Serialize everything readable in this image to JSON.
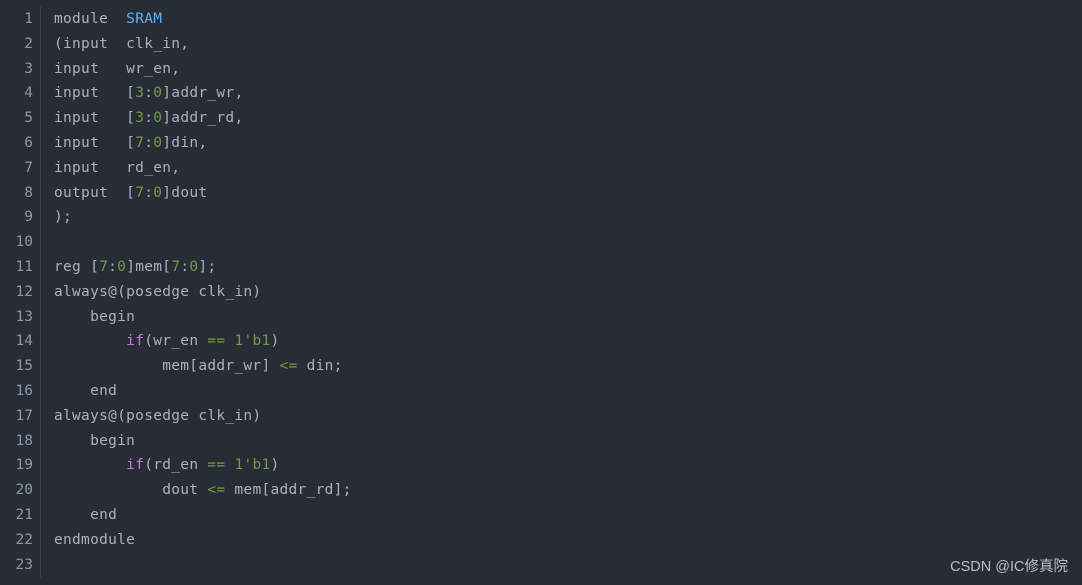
{
  "editor": {
    "language": "verilog",
    "background_color": "#282c34",
    "default_text_color": "#abb2bf",
    "gutter_text_color": "#8b98ab",
    "gutter_divider_color": "#3f4550",
    "total_lines": 23,
    "colors": {
      "type": "#61afef",
      "keyword": "#c678dd",
      "number": "#6f9b4b",
      "operator": "#6f9b4b",
      "plain": "#abb2bf"
    },
    "lines": [
      {
        "number": "1",
        "text": "module  SRAM",
        "tokens": [
          {
            "t": "module  ",
            "c": "plain"
          },
          {
            "t": "SRAM",
            "c": "type"
          }
        ]
      },
      {
        "number": "2",
        "text": "(input  clk_in,",
        "tokens": [
          {
            "t": "(input  clk_in,",
            "c": "plain"
          }
        ]
      },
      {
        "number": "3",
        "text": "input   wr_en,",
        "tokens": [
          {
            "t": "input   wr_en,",
            "c": "plain"
          }
        ]
      },
      {
        "number": "4",
        "text": "input   [3:0]addr_wr,",
        "tokens": [
          {
            "t": "input   [",
            "c": "plain"
          },
          {
            "t": "3",
            "c": "number"
          },
          {
            "t": ":",
            "c": "plain"
          },
          {
            "t": "0",
            "c": "number"
          },
          {
            "t": "]addr_wr,",
            "c": "plain"
          }
        ]
      },
      {
        "number": "5",
        "text": "input   [3:0]addr_rd,",
        "tokens": [
          {
            "t": "input   [",
            "c": "plain"
          },
          {
            "t": "3",
            "c": "number"
          },
          {
            "t": ":",
            "c": "plain"
          },
          {
            "t": "0",
            "c": "number"
          },
          {
            "t": "]addr_rd,",
            "c": "plain"
          }
        ]
      },
      {
        "number": "6",
        "text": "input   [7:0]din,",
        "tokens": [
          {
            "t": "input   [",
            "c": "plain"
          },
          {
            "t": "7",
            "c": "number"
          },
          {
            "t": ":",
            "c": "plain"
          },
          {
            "t": "0",
            "c": "number"
          },
          {
            "t": "]din,",
            "c": "plain"
          }
        ]
      },
      {
        "number": "7",
        "text": "input   rd_en,",
        "tokens": [
          {
            "t": "input   rd_en,",
            "c": "plain"
          }
        ]
      },
      {
        "number": "8",
        "text": "output  [7:0]dout",
        "tokens": [
          {
            "t": "output  [",
            "c": "plain"
          },
          {
            "t": "7",
            "c": "number"
          },
          {
            "t": ":",
            "c": "plain"
          },
          {
            "t": "0",
            "c": "number"
          },
          {
            "t": "]dout",
            "c": "plain"
          }
        ]
      },
      {
        "number": "9",
        "text": ");",
        "tokens": [
          {
            "t": ");",
            "c": "plain"
          }
        ]
      },
      {
        "number": "10",
        "text": "",
        "tokens": []
      },
      {
        "number": "11",
        "text": "reg [7:0]mem[7:0];",
        "tokens": [
          {
            "t": "reg [",
            "c": "plain"
          },
          {
            "t": "7",
            "c": "number"
          },
          {
            "t": ":",
            "c": "plain"
          },
          {
            "t": "0",
            "c": "number"
          },
          {
            "t": "]mem[",
            "c": "plain"
          },
          {
            "t": "7",
            "c": "number"
          },
          {
            "t": ":",
            "c": "plain"
          },
          {
            "t": "0",
            "c": "number"
          },
          {
            "t": "];",
            "c": "plain"
          }
        ]
      },
      {
        "number": "12",
        "text": "always@(posedge clk_in)",
        "tokens": [
          {
            "t": "always@(posedge clk_in)",
            "c": "plain"
          }
        ]
      },
      {
        "number": "13",
        "text": "    begin",
        "tokens": [
          {
            "t": "    begin",
            "c": "plain"
          }
        ]
      },
      {
        "number": "14",
        "text": "        if(wr_en == 1'b1)",
        "tokens": [
          {
            "t": "        ",
            "c": "plain"
          },
          {
            "t": "if",
            "c": "keyword"
          },
          {
            "t": "(wr_en ",
            "c": "plain"
          },
          {
            "t": "==",
            "c": "operator"
          },
          {
            "t": " ",
            "c": "plain"
          },
          {
            "t": "1'b1",
            "c": "number"
          },
          {
            "t": ")",
            "c": "plain"
          }
        ]
      },
      {
        "number": "15",
        "text": "            mem[addr_wr] <= din;",
        "tokens": [
          {
            "t": "            mem[addr_wr] ",
            "c": "plain"
          },
          {
            "t": "<=",
            "c": "operator"
          },
          {
            "t": " din;",
            "c": "plain"
          }
        ]
      },
      {
        "number": "16",
        "text": "    end",
        "tokens": [
          {
            "t": "    end",
            "c": "plain"
          }
        ]
      },
      {
        "number": "17",
        "text": "always@(posedge clk_in)",
        "tokens": [
          {
            "t": "always@(posedge clk_in)",
            "c": "plain"
          }
        ]
      },
      {
        "number": "18",
        "text": "    begin",
        "tokens": [
          {
            "t": "    begin",
            "c": "plain"
          }
        ]
      },
      {
        "number": "19",
        "text": "        if(rd_en == 1'b1)",
        "tokens": [
          {
            "t": "        ",
            "c": "plain"
          },
          {
            "t": "if",
            "c": "keyword"
          },
          {
            "t": "(rd_en ",
            "c": "plain"
          },
          {
            "t": "==",
            "c": "operator"
          },
          {
            "t": " ",
            "c": "plain"
          },
          {
            "t": "1'b1",
            "c": "number"
          },
          {
            "t": ")",
            "c": "plain"
          }
        ]
      },
      {
        "number": "20",
        "text": "            dout <= mem[addr_rd];",
        "tokens": [
          {
            "t": "            dout ",
            "c": "plain"
          },
          {
            "t": "<=",
            "c": "operator"
          },
          {
            "t": " mem[addr_rd];",
            "c": "plain"
          }
        ]
      },
      {
        "number": "21",
        "text": "    end",
        "tokens": [
          {
            "t": "    end",
            "c": "plain"
          }
        ]
      },
      {
        "number": "22",
        "text": "endmodule",
        "tokens": [
          {
            "t": "endmodule",
            "c": "plain"
          }
        ]
      },
      {
        "number": "23",
        "text": "",
        "tokens": []
      }
    ]
  },
  "watermark": {
    "text": "CSDN @IC修真院"
  }
}
